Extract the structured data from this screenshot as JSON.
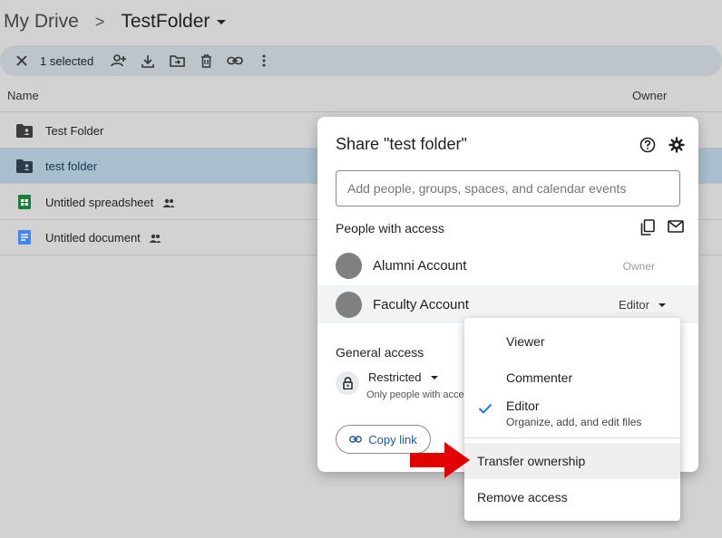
{
  "breadcrumb": {
    "root": "My Drive",
    "separator": ">",
    "current": "TestFolder"
  },
  "toolbar": {
    "selected_count": "1 selected",
    "icons": [
      "close-icon",
      "add-person-icon",
      "download-icon",
      "move-icon",
      "trash-icon",
      "link-icon",
      "more-vert-icon"
    ]
  },
  "list": {
    "columns": {
      "name": "Name",
      "owner": "Owner"
    },
    "rows": [
      {
        "name": "Test Folder",
        "icon": "shared-folder-icon",
        "selected": false,
        "shared": false
      },
      {
        "name": "test folder",
        "icon": "shared-folder-icon",
        "selected": true,
        "shared": false
      },
      {
        "name": "Untitled spreadsheet",
        "icon": "sheets-icon",
        "selected": false,
        "shared": true
      },
      {
        "name": "Untitled document",
        "icon": "docs-icon",
        "selected": false,
        "shared": true
      }
    ]
  },
  "dialog": {
    "title": "Share \"test folder\"",
    "input_placeholder": "Add people, groups, spaces, and calendar events",
    "people_heading": "People with access",
    "people": [
      {
        "name": "Alumni Account",
        "role": "Owner"
      },
      {
        "name": "Faculty Account",
        "role": "Editor"
      }
    ],
    "general_heading": "General access",
    "general_setting": "Restricted",
    "general_description": "Only people with access",
    "copy_link_label": "Copy link"
  },
  "role_menu": {
    "items": [
      {
        "label": "Viewer",
        "checked": false
      },
      {
        "label": "Commenter",
        "checked": false
      },
      {
        "label": "Editor",
        "sub": "Organize, add, and edit files",
        "checked": true
      }
    ],
    "actions": [
      {
        "label": "Transfer ownership",
        "highlighted": true
      },
      {
        "label": "Remove access",
        "highlighted": false
      }
    ]
  },
  "colors": {
    "accent": "#1a73e8",
    "selected_row": "#a9bfce",
    "arrow": "#e30000",
    "toolbar": "#bdc4ca"
  }
}
